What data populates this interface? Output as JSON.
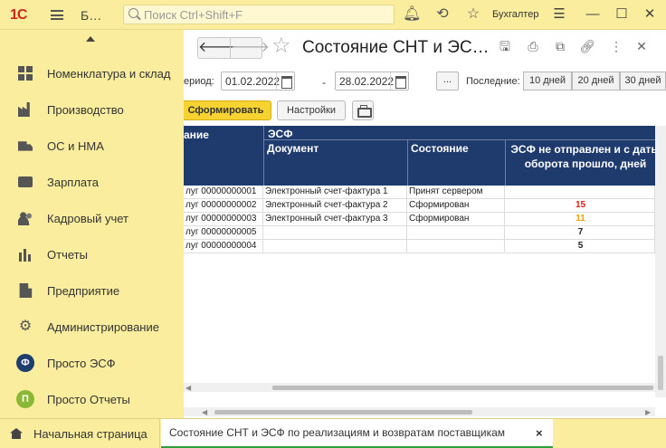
{
  "titlebar": {
    "logo": "1С",
    "app_title": "Б…",
    "search_placeholder": "Поиск Ctrl+Shift+F",
    "user": "Бухгалтер"
  },
  "sidebar": {
    "items": [
      {
        "label": "Номенклатура и склад",
        "icon": "grid-icon"
      },
      {
        "label": "Производство",
        "icon": "factory-icon"
      },
      {
        "label": "ОС и НМА",
        "icon": "truck-icon"
      },
      {
        "label": "Зарплата",
        "icon": "wallet-icon"
      },
      {
        "label": "Кадровый учет",
        "icon": "people-icon"
      },
      {
        "label": "Отчеты",
        "icon": "bar-chart-icon"
      },
      {
        "label": "Предприятие",
        "icon": "building-icon"
      },
      {
        "label": "Администрирование",
        "icon": "gear-icon"
      },
      {
        "label": "Просто ЭСФ",
        "icon": "esf-logo-icon"
      },
      {
        "label": "Просто Отчеты",
        "icon": "reports-logo-icon"
      }
    ]
  },
  "document": {
    "title": "Состояние СНТ и ЭС…",
    "period_label": "ериод:",
    "date_from": "01.02.2022",
    "date_to": "28.02.2022",
    "dash": "-",
    "dots": "...",
    "last_label": "Последние:",
    "day_buttons": [
      "10 дней",
      "20 дней",
      "30 дней"
    ],
    "generate_btn": "Сформировать",
    "settings_btn": "Настройки"
  },
  "report": {
    "header_left": "ание",
    "header_group": "ЭСФ",
    "col_document": "Документ",
    "col_state": "Состояние",
    "col_overdue": "ЭСФ не отправлен и с даты оборота прошло, дней",
    "rows": [
      {
        "name": "луг 00000000001",
        "doc": "Электронный счет-фактура 1",
        "state": "Принят сервером",
        "days": ""
      },
      {
        "name": "луг 00000000002",
        "doc": "Электронный счет-фактура 2",
        "state": "Сформирован",
        "days": "15"
      },
      {
        "name": "луг 00000000003",
        "doc": "Электронный счет-фактура 3",
        "state": "Сформирован",
        "days": "11"
      },
      {
        "name": "луг 00000000005",
        "doc": "",
        "state": "",
        "days": "7"
      },
      {
        "name": "луг 00000000004",
        "doc": "",
        "state": "",
        "days": "5"
      }
    ]
  },
  "tabs": {
    "home": "Начальная страница",
    "current": "Состояние СНТ и ЭСФ по реализациям и возвратам поставщикам",
    "close": "×"
  },
  "colors": {
    "accent": "#fbed9e",
    "header_blue": "#1f3a6d",
    "primary_btn": "#f7d331",
    "overdue_red": "#e11d1d",
    "overdue_orange": "#f0a000",
    "active_tab": "#2f9e3d"
  }
}
